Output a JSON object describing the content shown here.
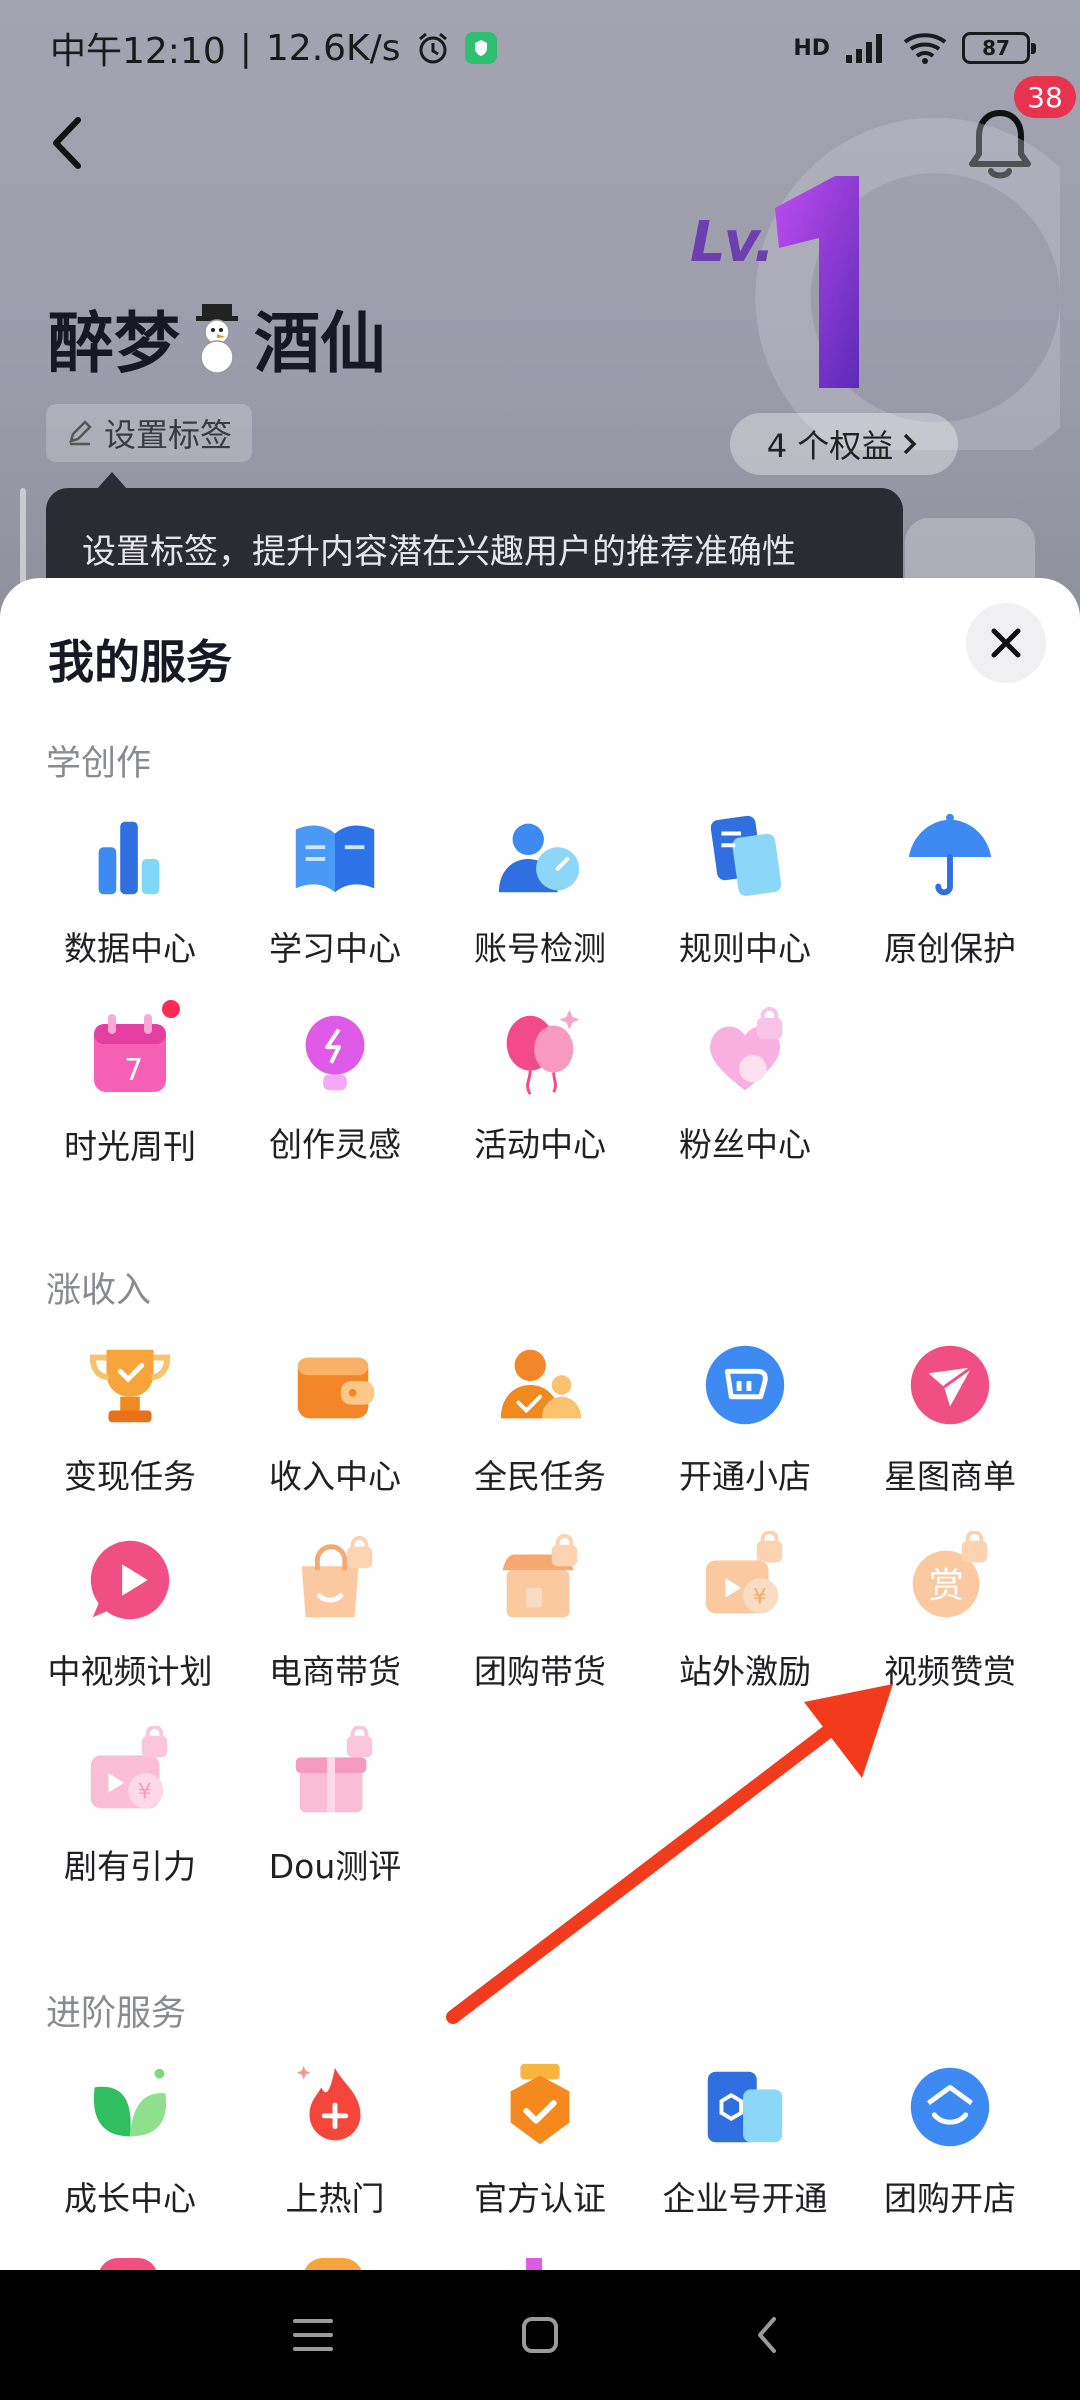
{
  "status": {
    "time": "中午12:10",
    "speed": "12.6K/s",
    "network": "HD",
    "battery": "87"
  },
  "header": {
    "notification_count": "38",
    "level_label": "Lv.",
    "level_value": "1",
    "profile_name_left": "醉梦",
    "profile_name_right": "酒仙",
    "tag_button": "设置标签",
    "benefits_button": "4 个权益",
    "tooltip": "设置标签，提升内容潜在兴趣用户的推荐准确性"
  },
  "sheet": {
    "title": "我的服务",
    "sections": [
      {
        "title": "学创作",
        "items": [
          {
            "label": "数据中心",
            "icon": "bar-chart-icon"
          },
          {
            "label": "学习中心",
            "icon": "open-book-icon"
          },
          {
            "label": "账号检测",
            "icon": "user-gauge-icon"
          },
          {
            "label": "规则中心",
            "icon": "rule-doc-icon"
          },
          {
            "label": "原创保护",
            "icon": "umbrella-icon"
          },
          {
            "label": "时光周刊",
            "icon": "calendar-icon"
          },
          {
            "label": "创作灵感",
            "icon": "lightbulb-icon"
          },
          {
            "label": "活动中心",
            "icon": "balloons-icon"
          },
          {
            "label": "粉丝中心",
            "icon": "heart-lock-icon"
          }
        ]
      },
      {
        "title": "涨收入",
        "items": [
          {
            "label": "变现任务",
            "icon": "trophy-icon"
          },
          {
            "label": "收入中心",
            "icon": "wallet-icon"
          },
          {
            "label": "全民任务",
            "icon": "people-check-icon"
          },
          {
            "label": "开通小店",
            "icon": "shop-circle-icon"
          },
          {
            "label": "星图商单",
            "icon": "star-map-icon"
          },
          {
            "label": "中视频计划",
            "icon": "play-bubble-icon"
          },
          {
            "label": "电商带货",
            "icon": "shopping-bag-icon"
          },
          {
            "label": "团购带货",
            "icon": "storefront-icon"
          },
          {
            "label": "站外激励",
            "icon": "video-coin-icon"
          },
          {
            "label": "视频赞赏",
            "icon": "reward-icon"
          },
          {
            "label": "剧有引力",
            "icon": "drama-icon"
          },
          {
            "label": "Dou测评",
            "icon": "gift-box-icon"
          }
        ]
      },
      {
        "title": "进阶服务",
        "items": [
          {
            "label": "成长中心",
            "icon": "leaf-icon"
          },
          {
            "label": "上热门",
            "icon": "flame-plus-icon"
          },
          {
            "label": "官方认证",
            "icon": "badge-check-icon"
          },
          {
            "label": "企业号开通",
            "icon": "enterprise-icon"
          },
          {
            "label": "团购开店",
            "icon": "smile-store-icon"
          }
        ]
      }
    ]
  },
  "colors": {
    "accent_red": "#fe2c55",
    "arrow_red": "#f23a1d",
    "section_gray": "#8a8b91"
  }
}
